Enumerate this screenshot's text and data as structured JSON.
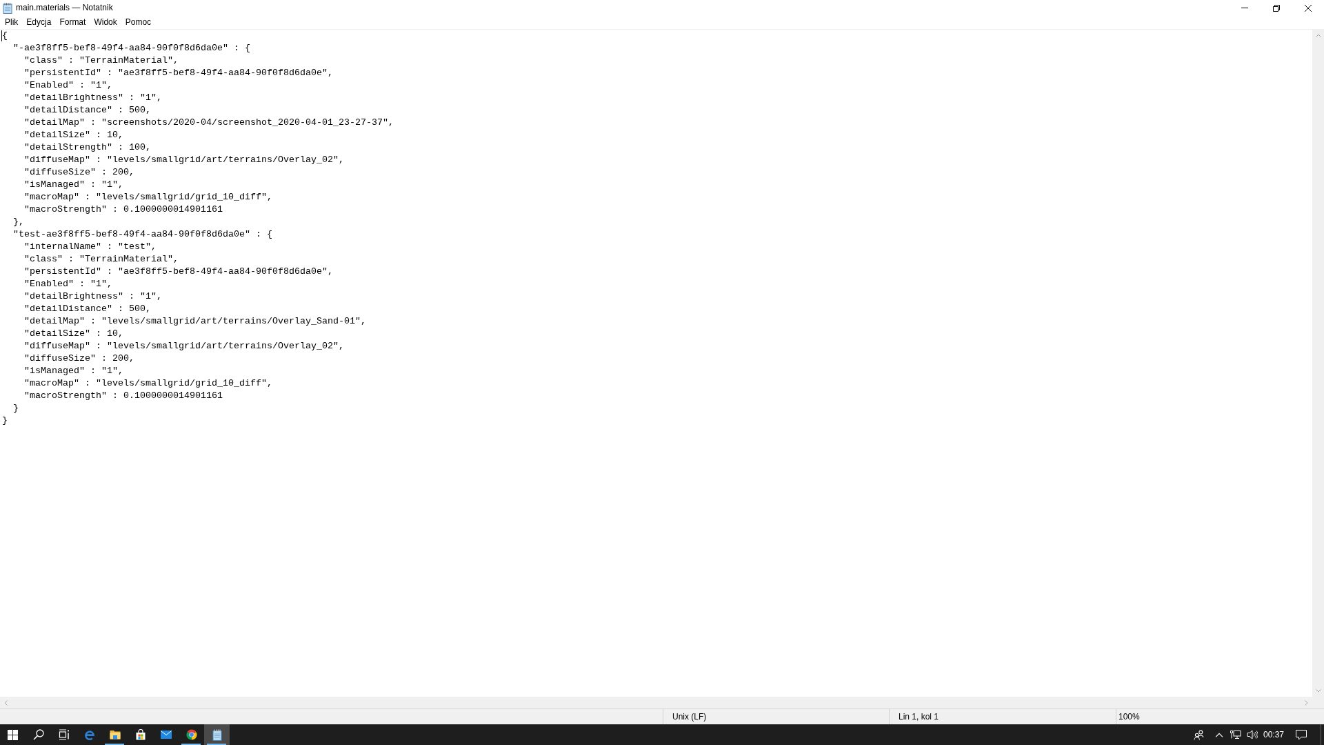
{
  "window": {
    "title": "main.materials — Notatnik"
  },
  "menu": [
    "Plik",
    "Edycja",
    "Format",
    "Widok",
    "Pomoc"
  ],
  "editor": {
    "lines": [
      {
        "text": "{",
        "children": [
          {
            "text": "\"-ae3f8ff5-bef8-49f4-aa84-90f0f8d6da0e\" : {",
            "children": [
              {
                "text": "\"class\" : \"TerrainMaterial\","
              },
              {
                "text": "\"persistentId\" : \"ae3f8ff5-bef8-49f4-aa84-90f0f8d6da0e\","
              },
              {
                "text": "\"Enabled\" : \"1\","
              },
              {
                "text": "\"detailBrightness\" : \"1\","
              },
              {
                "text": "\"detailDistance\" : 500,"
              },
              {
                "text": "\"detailMap\" : \"screenshots/2020-04/screenshot_2020-04-01_23-27-37\","
              },
              {
                "text": "\"detailSize\" : 10,"
              },
              {
                "text": "\"detailStrength\" : 100,"
              },
              {
                "text": "\"diffuseMap\" : \"levels/smallgrid/art/terrains/Overlay_02\","
              },
              {
                "text": "\"diffuseSize\" : 200,"
              },
              {
                "text": "\"isManaged\" : \"1\","
              },
              {
                "text": "\"macroMap\" : \"levels/smallgrid/grid_10_diff\","
              },
              {
                "text": "\"macroStrength\" : 0.1000000014901161"
              }
            ]
          },
          {
            "text": "},"
          },
          {
            "text": "\"test-ae3f8ff5-bef8-49f4-aa84-90f0f8d6da0e\" : {",
            "children": [
              {
                "text": "\"internalName\" : \"test\","
              },
              {
                "text": "\"class\" : \"TerrainMaterial\","
              },
              {
                "text": "\"persistentId\" : \"ae3f8ff5-bef8-49f4-aa84-90f0f8d6da0e\","
              },
              {
                "text": "\"Enabled\" : \"1\","
              },
              {
                "text": "\"detailBrightness\" : \"1\","
              },
              {
                "text": "\"detailDistance\" : 500,"
              },
              {
                "text": "\"detailMap\" : \"levels/smallgrid/art/terrains/Overlay_Sand-01\","
              },
              {
                "text": "\"detailSize\" : 10,"
              },
              {
                "text": "\"diffuseMap\" : \"levels/smallgrid/art/terrains/Overlay_02\","
              },
              {
                "text": "\"diffuseSize\" : 200,"
              },
              {
                "text": "\"isManaged\" : \"1\","
              },
              {
                "text": "\"macroMap\" : \"levels/smallgrid/grid_10_diff\","
              },
              {
                "text": "\"macroStrength\" : 0.1000000014901161"
              }
            ]
          },
          {
            "text": "}"
          }
        ]
      },
      {
        "text": "}"
      }
    ]
  },
  "status_bar": {
    "line_ending": "Unix (LF)",
    "position": "Lin 1, kol 1",
    "zoom": "100%"
  },
  "taskbar": {
    "apps": [
      {
        "kind": "edge",
        "running": false,
        "selected": false
      },
      {
        "kind": "explorer",
        "running": true,
        "selected": false
      },
      {
        "kind": "store",
        "running": false,
        "selected": false
      },
      {
        "kind": "mail",
        "running": false,
        "selected": false
      },
      {
        "kind": "chrome",
        "running": true,
        "selected": false
      },
      {
        "kind": "notepad",
        "running": true,
        "selected": true
      }
    ],
    "clock": "00:37"
  }
}
